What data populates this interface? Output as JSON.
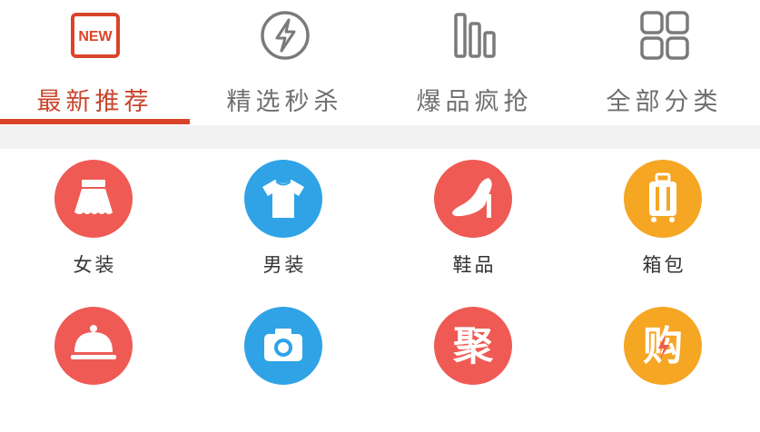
{
  "tabs": [
    {
      "label": "最新推荐",
      "icon": "new-badge-icon",
      "badge_text": "NEW",
      "active": true
    },
    {
      "label": "精选秒杀",
      "icon": "lightning-icon",
      "active": false
    },
    {
      "label": "爆品疯抢",
      "icon": "bar-chart-icon",
      "active": false
    },
    {
      "label": "全部分类",
      "icon": "grid-icon",
      "active": false
    }
  ],
  "categories": [
    {
      "label": "女装",
      "icon": "skirt-icon",
      "color": "#ef5a55"
    },
    {
      "label": "男装",
      "icon": "tshirt-icon",
      "color": "#2fa3e6"
    },
    {
      "label": "鞋品",
      "icon": "high-heel-icon",
      "color": "#ef5a55"
    },
    {
      "label": "箱包",
      "icon": "suitcase-icon",
      "color": "#f5a623"
    },
    {
      "label": "",
      "icon": "food-cloche-icon",
      "color": "#ef5a55"
    },
    {
      "label": "",
      "icon": "camera-icon",
      "color": "#2fa3e6"
    },
    {
      "label": "",
      "icon": "ju-badge-icon",
      "glyph": "聚",
      "color": "#ef5a55"
    },
    {
      "label": "",
      "icon": "gou-badge-icon",
      "glyph": "购",
      "color": "#f5a623"
    }
  ],
  "colors": {
    "accent": "#d9452a",
    "tab_inactive": "#6f6f6f",
    "divider": "#f2f2f2"
  }
}
